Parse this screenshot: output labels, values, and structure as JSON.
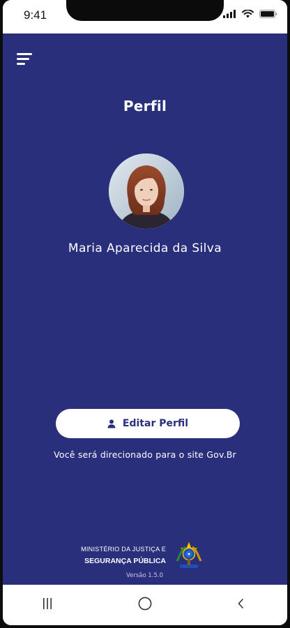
{
  "status_bar": {
    "time": "9:41",
    "icons": [
      "signal-icon",
      "wifi-icon",
      "battery-icon"
    ]
  },
  "app": {
    "background_color": "#2a2f7c",
    "menu_icon": "hamburger-menu-icon",
    "title": "Perfil",
    "avatar": "user-avatar-photo",
    "user_name": "Maria Aparecida da Silva",
    "edit_button": {
      "icon": "user-icon",
      "label": "Editar Perfil"
    },
    "redirect_note": "Você será direcionado para o site Gov.Br"
  },
  "footer": {
    "ministry_line1": "MINISTÉRIO DA JUSTIÇA E",
    "ministry_line2": "SEGURANÇA PÚBLICA",
    "emblem": "brazil-coat-of-arms-icon",
    "version": "Versão 1.5.0"
  },
  "nav_bar": {
    "items": [
      "recent-apps-icon",
      "home-icon",
      "back-icon"
    ]
  }
}
